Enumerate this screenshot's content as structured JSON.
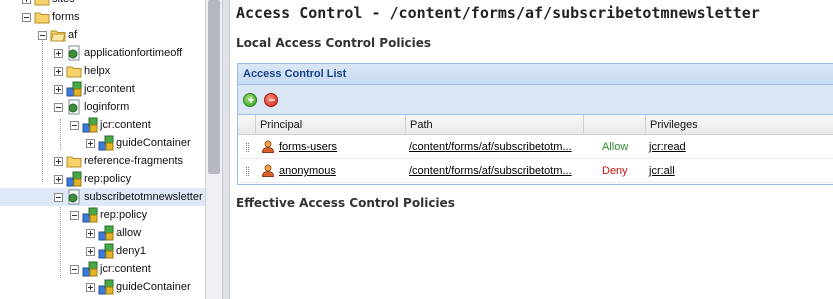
{
  "tree": {
    "nodes": [
      {
        "label": "sites",
        "icon": "folder-icon",
        "toggle": "plus"
      },
      {
        "label": "forms",
        "icon": "folder-icon",
        "toggle": "minus"
      },
      {
        "label": "af",
        "icon": "folder-icon",
        "toggle": "minus"
      },
      {
        "label": "applicationfortimeoff",
        "icon": "page-icon",
        "toggle": "plus"
      },
      {
        "label": "helpx",
        "icon": "folder-icon",
        "toggle": "plus"
      },
      {
        "label": "jcr:content",
        "icon": "node-icon",
        "toggle": "plus"
      },
      {
        "label": "loginform",
        "icon": "page-icon",
        "toggle": "minus"
      },
      {
        "label": "jcr:content",
        "icon": "node-icon",
        "toggle": "minus"
      },
      {
        "label": "guideContainer",
        "icon": "node-icon",
        "toggle": "plus"
      },
      {
        "label": "reference-fragments",
        "icon": "folder-icon",
        "toggle": "plus"
      },
      {
        "label": "rep:policy",
        "icon": "node-icon",
        "toggle": "plus"
      },
      {
        "label": "subscribetotmnewsletter",
        "icon": "page-icon",
        "toggle": "minus",
        "selected": true
      },
      {
        "label": "rep:policy",
        "icon": "node-icon",
        "toggle": "minus"
      },
      {
        "label": "allow",
        "icon": "node-icon",
        "toggle": "plus"
      },
      {
        "label": "deny1",
        "icon": "node-icon",
        "toggle": "plus"
      },
      {
        "label": "jcr:content",
        "icon": "node-icon",
        "toggle": "minus"
      },
      {
        "label": "guideContainer",
        "icon": "node-icon",
        "toggle": "plus"
      }
    ]
  },
  "main": {
    "title": "Access Control - /content/forms/af/subscribetotmnewsletter",
    "local_heading": "Local Access Control Policies",
    "acl": {
      "header": "Access Control List",
      "columns": [
        "Principal",
        "Path",
        "",
        "Privileges"
      ],
      "rows": [
        {
          "principal": "forms-users",
          "path": "/content/forms/af/subscribetotm...",
          "type": "Allow",
          "privileges": "jcr:read"
        },
        {
          "principal": "anonymous",
          "path": "/content/forms/af/subscribetotm...",
          "type": "Deny",
          "privileges": "jcr:all"
        }
      ]
    },
    "effective_heading": "Effective Access Control Policies"
  },
  "colors": {
    "allow": "#2e8b2e",
    "deny": "#cc1111",
    "panel_title": "#15428b",
    "selected_row": "#dfe8f6"
  }
}
